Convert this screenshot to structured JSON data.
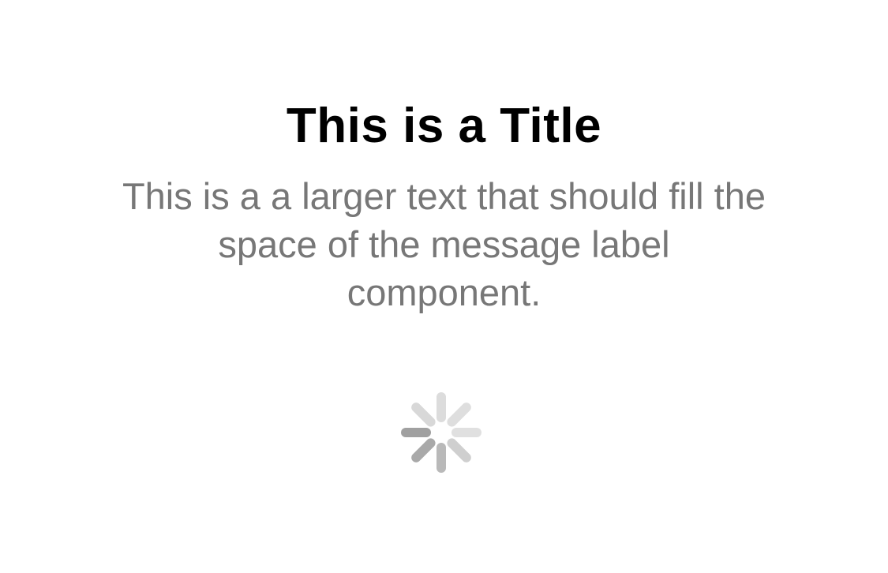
{
  "title": "This is a Title",
  "message": "This is a a larger text that should fill the space of the message label component.",
  "spinner": {
    "icon": "activity-indicator-icon",
    "spoke_colors": [
      "#dcdcdc",
      "#dedede",
      "#e0e0e0",
      "#cfcfcf",
      "#b9b9b9",
      "#a9a9a9",
      "#a0a0a0",
      "#d8d8d8"
    ]
  }
}
